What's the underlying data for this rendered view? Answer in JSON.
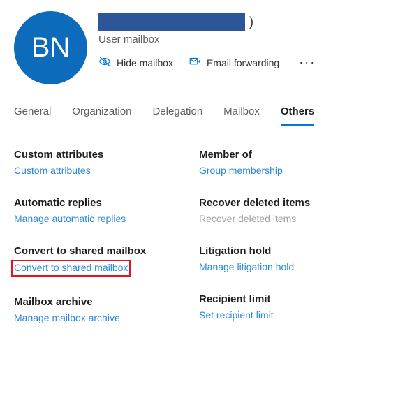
{
  "profile": {
    "initials": "BN",
    "name_trailing": ")",
    "type": "User mailbox"
  },
  "actions": {
    "hide_mailbox": "Hide mailbox",
    "email_forwarding": "Email forwarding"
  },
  "tabs": [
    {
      "label": "General",
      "active": false
    },
    {
      "label": "Organization",
      "active": false
    },
    {
      "label": "Delegation",
      "active": false
    },
    {
      "label": "Mailbox",
      "active": false
    },
    {
      "label": "Others",
      "active": true
    }
  ],
  "sections": {
    "left": [
      {
        "title": "Custom attributes",
        "link": "Custom attributes",
        "highlighted": false,
        "disabled": false
      },
      {
        "title": "Automatic replies",
        "link": "Manage automatic replies",
        "highlighted": false,
        "disabled": false
      },
      {
        "title": "Convert to shared mailbox",
        "link": "Convert to shared mailbox",
        "highlighted": true,
        "disabled": false
      },
      {
        "title": "Mailbox archive",
        "link": "Manage mailbox archive",
        "highlighted": false,
        "disabled": false
      }
    ],
    "right": [
      {
        "title": "Member of",
        "link": "Group membership",
        "highlighted": false,
        "disabled": false
      },
      {
        "title": "Recover deleted items",
        "link": "Recover deleted items",
        "highlighted": false,
        "disabled": true
      },
      {
        "title": "Litigation hold",
        "link": "Manage litigation hold",
        "highlighted": false,
        "disabled": false
      },
      {
        "title": "Recipient limit",
        "link": "Set recipient limit",
        "highlighted": false,
        "disabled": false
      }
    ]
  }
}
